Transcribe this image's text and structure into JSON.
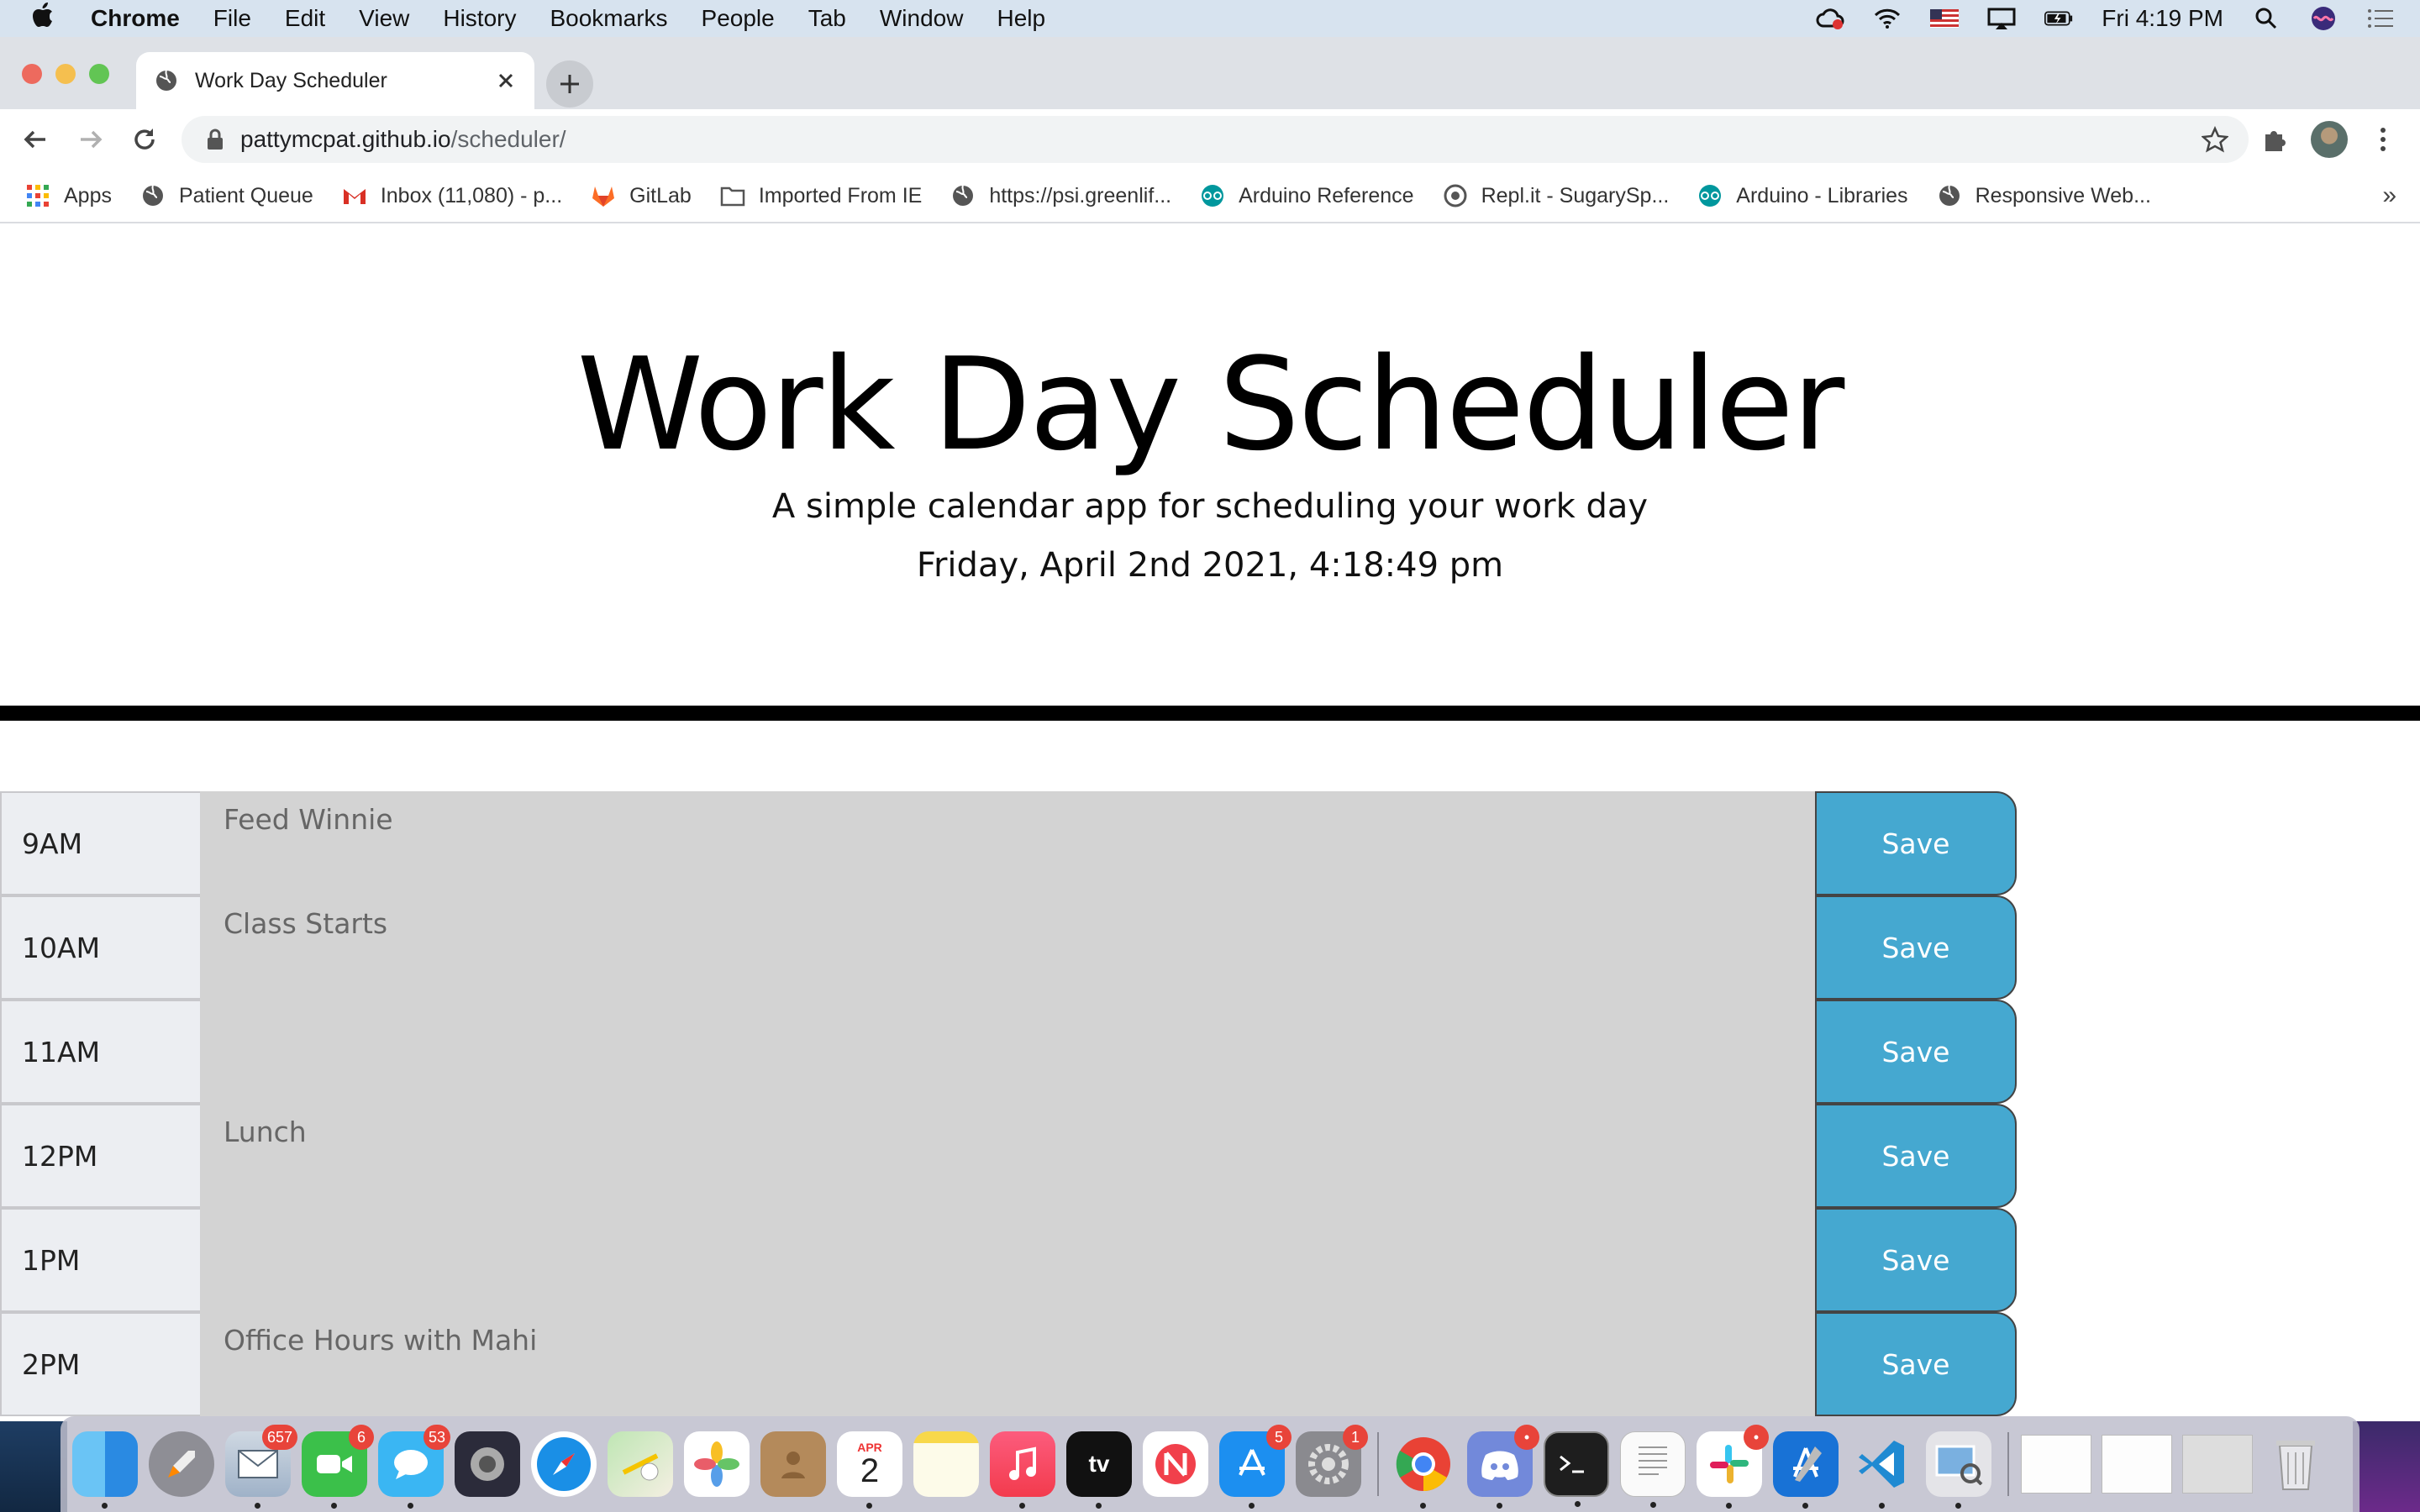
{
  "menubar": {
    "app_name": "Chrome",
    "items": [
      "File",
      "Edit",
      "View",
      "History",
      "Bookmarks",
      "People",
      "Tab",
      "Window",
      "Help"
    ],
    "clock": "Fri 4:19 PM"
  },
  "browser": {
    "tab_title": "Work Day Scheduler",
    "url_host": "pattymcpat.github.io",
    "url_path": "/scheduler/",
    "bookmarks": [
      {
        "label": "Apps",
        "icon": "apps-grid-icon"
      },
      {
        "label": "Patient Queue",
        "icon": "globe-icon"
      },
      {
        "label": "Inbox (11,080) - p...",
        "icon": "gmail-icon"
      },
      {
        "label": "GitLab",
        "icon": "gitlab-icon"
      },
      {
        "label": "Imported From IE",
        "icon": "folder-icon"
      },
      {
        "label": "https://psi.greenlif...",
        "icon": "globe-icon"
      },
      {
        "label": "Arduino Reference",
        "icon": "arduino-icon"
      },
      {
        "label": "Repl.it - SugarySp...",
        "icon": "replit-icon"
      },
      {
        "label": "Arduino - Libraries",
        "icon": "arduino-icon"
      },
      {
        "label": "Responsive Web...",
        "icon": "globe-icon"
      }
    ],
    "bookmarks_overflow": "»"
  },
  "page": {
    "title": "Work Day Scheduler",
    "lead": "A simple calendar app for scheduling your work day",
    "current_day": "Friday, April 2nd 2021, 4:18:49 pm"
  },
  "schedule": [
    {
      "hour": "9AM",
      "text": "Feed Winnie",
      "save": "Save",
      "state": "past"
    },
    {
      "hour": "10AM",
      "text": "Class Starts",
      "save": "Save",
      "state": "past"
    },
    {
      "hour": "11AM",
      "text": "",
      "save": "Save",
      "state": "past"
    },
    {
      "hour": "12PM",
      "text": "Lunch",
      "save": "Save",
      "state": "past"
    },
    {
      "hour": "1PM",
      "text": "",
      "save": "Save",
      "state": "past"
    },
    {
      "hour": "2PM",
      "text": "Office Hours with Mahi",
      "save": "Save",
      "state": "past"
    }
  ],
  "colors": {
    "past": "#d3d3d3",
    "save_button": "#45a8d0",
    "hour_bg": "#eceef2"
  },
  "dock": {
    "apps": [
      {
        "name": "finder-icon",
        "badge": ""
      },
      {
        "name": "launchpad-icon",
        "badge": ""
      },
      {
        "name": "mail-icon",
        "badge": "657"
      },
      {
        "name": "facetime-icon",
        "badge": "6"
      },
      {
        "name": "messages-icon",
        "badge": "53"
      },
      {
        "name": "siri-icon",
        "badge": ""
      },
      {
        "name": "safari-icon",
        "badge": ""
      },
      {
        "name": "maps-icon",
        "badge": ""
      },
      {
        "name": "photos-icon",
        "badge": ""
      },
      {
        "name": "contacts-icon",
        "badge": ""
      },
      {
        "name": "calendar-icon",
        "badge": ""
      },
      {
        "name": "notes-icon",
        "badge": ""
      },
      {
        "name": "music-icon",
        "badge": ""
      },
      {
        "name": "appletv-icon",
        "badge": ""
      },
      {
        "name": "news-icon",
        "badge": ""
      },
      {
        "name": "appstore-icon",
        "badge": "5"
      },
      {
        "name": "system-preferences-icon",
        "badge": "1"
      },
      {
        "name": "chrome-icon",
        "badge": ""
      },
      {
        "name": "discord-icon",
        "badge": "•"
      },
      {
        "name": "terminal-icon",
        "badge": ""
      },
      {
        "name": "textedit-icon",
        "badge": ""
      },
      {
        "name": "slack-icon",
        "badge": "•"
      },
      {
        "name": "xcode-icon",
        "badge": ""
      },
      {
        "name": "vscode-icon",
        "badge": ""
      },
      {
        "name": "preview-icon",
        "badge": ""
      }
    ],
    "calendar_month": "APR",
    "calendar_day": "2",
    "appletv_label": "tv"
  }
}
